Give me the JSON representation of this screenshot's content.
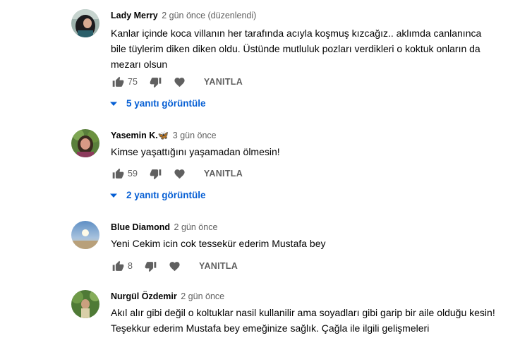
{
  "comments": [
    {
      "author": "Lady Merry",
      "meta": "2 gün önce (düzenlendi)",
      "text": "Kanlar içinde koca villanın her tarafında acıyla koşmuş kızcağız.. aklımda canlanınca bile tüylerim diken diken oldu. Üstünde mutluluk pozları verdikleri o koktuk onların da mezarı olsun",
      "likes": "75",
      "reply_label": "YANITLA",
      "replies_label": "5 yanıtı görüntüle"
    },
    {
      "author": "Yasemin K.",
      "author_emoji": "🦋",
      "meta": "3 gün önce",
      "text": "Kimse yaşattığını yaşamadan ölmesin!",
      "likes": "59",
      "reply_label": "YANITLA",
      "replies_label": "2 yanıtı görüntüle"
    },
    {
      "author": "Blue Diamond",
      "meta": "2 gün önce",
      "text": "Yeni Cekim icin cok tessekür ederim Mustafa bey",
      "likes": "8",
      "reply_label": "YANITLA"
    },
    {
      "author": "Nurgül Özdemir",
      "meta": "2 gün önce",
      "text": "Akıl alır gibi değil o koltuklar nasil kullanilir ama soyadları gibi garip bir aile olduğu kesin! Teşekkur ederim Mustafa bey emeğinize sağlık. Çağla ile ilgili gelişmeleri"
    }
  ],
  "icons": {
    "like": "thumb-up-icon",
    "dislike": "thumb-down-icon",
    "heart": "heart-icon",
    "expand": "caret-down-icon"
  },
  "colors": {
    "link": "#065fd4",
    "meta": "#606060",
    "text": "#030303"
  }
}
